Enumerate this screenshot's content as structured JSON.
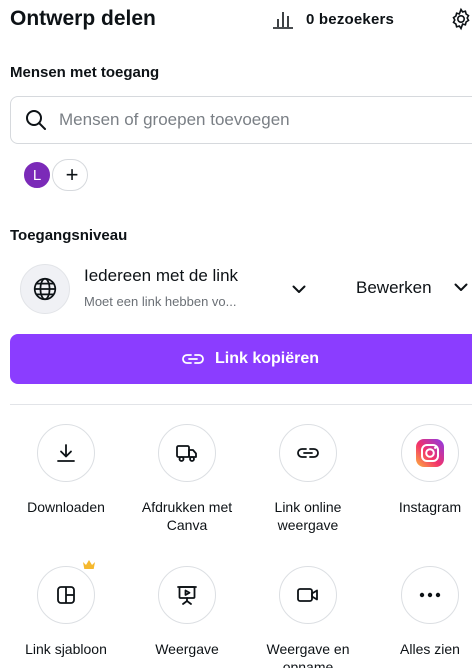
{
  "header": {
    "title": "Ontwerp delen",
    "visitors_label": "0 bezoekers"
  },
  "people": {
    "section_label": "Mensen met toegang",
    "search_placeholder": "Mensen of groepen toevoegen",
    "avatar_initial": "L",
    "avatar_color": "#7b2ab8",
    "add_symbol": "+"
  },
  "access": {
    "section_label": "Toegangsniveau",
    "level": "Iedereen met de link",
    "level_sub": "Moet een link hebben vo...",
    "permission": "Bewerken"
  },
  "copy_button": {
    "label": "Link kopiëren",
    "color": "#8b3dff"
  },
  "actions": [
    {
      "label": "Downloaden",
      "icon": "download-icon"
    },
    {
      "label": "Afdrukken met Canva",
      "icon": "truck-icon"
    },
    {
      "label": "Link online weergave",
      "icon": "link-icon"
    },
    {
      "label": "Instagram",
      "icon": "instagram-icon"
    },
    {
      "label": "Link sjabloon",
      "icon": "template-icon"
    },
    {
      "label": "Weergave",
      "icon": "presentation-icon"
    },
    {
      "label": "Weergave en opname",
      "icon": "video-record-icon"
    },
    {
      "label": "Alles zien",
      "icon": "more-icon"
    }
  ]
}
